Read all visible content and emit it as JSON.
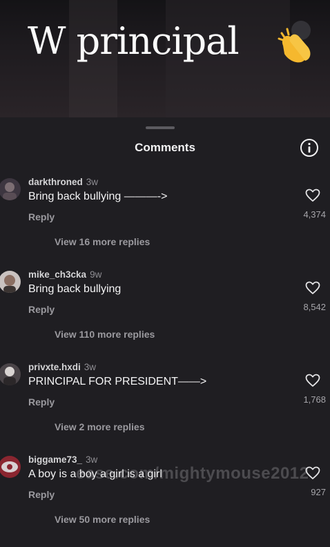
{
  "video": {
    "caption": "W principal",
    "caption_emoji": "clapping-hands-icon"
  },
  "sheet": {
    "title": "Comments",
    "info_icon": "info-icon"
  },
  "comments": [
    {
      "username": "darkthroned",
      "age": "3w",
      "text": "Bring back bullying ———->",
      "reply_label": "Reply",
      "view_replies": "View 16 more replies",
      "likes": "4,374",
      "avatar_color": "#3d3640"
    },
    {
      "username": "mike_ch3cka",
      "age": "9w",
      "text": "Bring back bullying",
      "reply_label": "Reply",
      "view_replies": "View 110 more replies",
      "likes": "8,542",
      "avatar_color": "#7a6a66"
    },
    {
      "username": "privxte.hxdi",
      "age": "3w",
      "text": "PRINCIPAL FOR PRESIDENT——>",
      "reply_label": "Reply",
      "view_replies": "View 2 more replies",
      "likes": "1,768",
      "avatar_color": "#4a4448"
    },
    {
      "username": "biggame73_",
      "age": "3w",
      "text": "A boy is a boy a girl is a girl",
      "reply_label": "Reply",
      "view_replies": "View 50 more replies",
      "likes": "927",
      "avatar_color": "#8a2630"
    }
  ],
  "watermark": "ease.com/mightymouse2012",
  "colors": {
    "background": "#1f1e22",
    "text_primary": "#f4f4f5",
    "text_secondary": "#9b9a9f"
  }
}
